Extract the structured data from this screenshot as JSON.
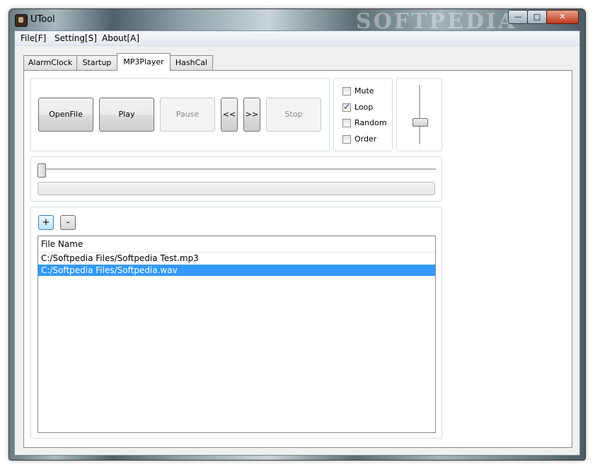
{
  "window": {
    "title": "UTool",
    "watermark": "SOFTPEDIA",
    "controls": {
      "minimize": "—",
      "maximize": "□",
      "close": "✕"
    }
  },
  "menu": [
    {
      "label": "File[F]"
    },
    {
      "label": "Setting[S]"
    },
    {
      "label": "About[A]"
    }
  ],
  "tabs": [
    {
      "label": "AlarmClock",
      "active": false
    },
    {
      "label": "Startup",
      "active": false
    },
    {
      "label": "MP3Player",
      "active": true
    },
    {
      "label": "HashCal",
      "active": false
    }
  ],
  "player": {
    "buttons": {
      "open": "OpenFile",
      "play": "Play",
      "pause": "Pause",
      "prev": "<<",
      "next": ">>",
      "stop": "Stop"
    },
    "options": [
      {
        "label": "Mute",
        "checked": false
      },
      {
        "label": "Loop",
        "checked": true
      },
      {
        "label": "Random",
        "checked": false
      },
      {
        "label": "Order",
        "checked": false
      }
    ],
    "volume_level": 0.4,
    "seek_position": 0.0,
    "progress": 0.0
  },
  "playlist": {
    "add_label": "+",
    "remove_label": "-",
    "column_header": "File Name",
    "files": [
      {
        "name": "C:/Softpedia Files/Softpedia Test.mp3",
        "selected": false
      },
      {
        "name": "C:/Softpedia Files/Softpedia.wav",
        "selected": true
      }
    ]
  },
  "colors": {
    "selection": "#3399ff",
    "client_bg": "#f0f0f0"
  }
}
